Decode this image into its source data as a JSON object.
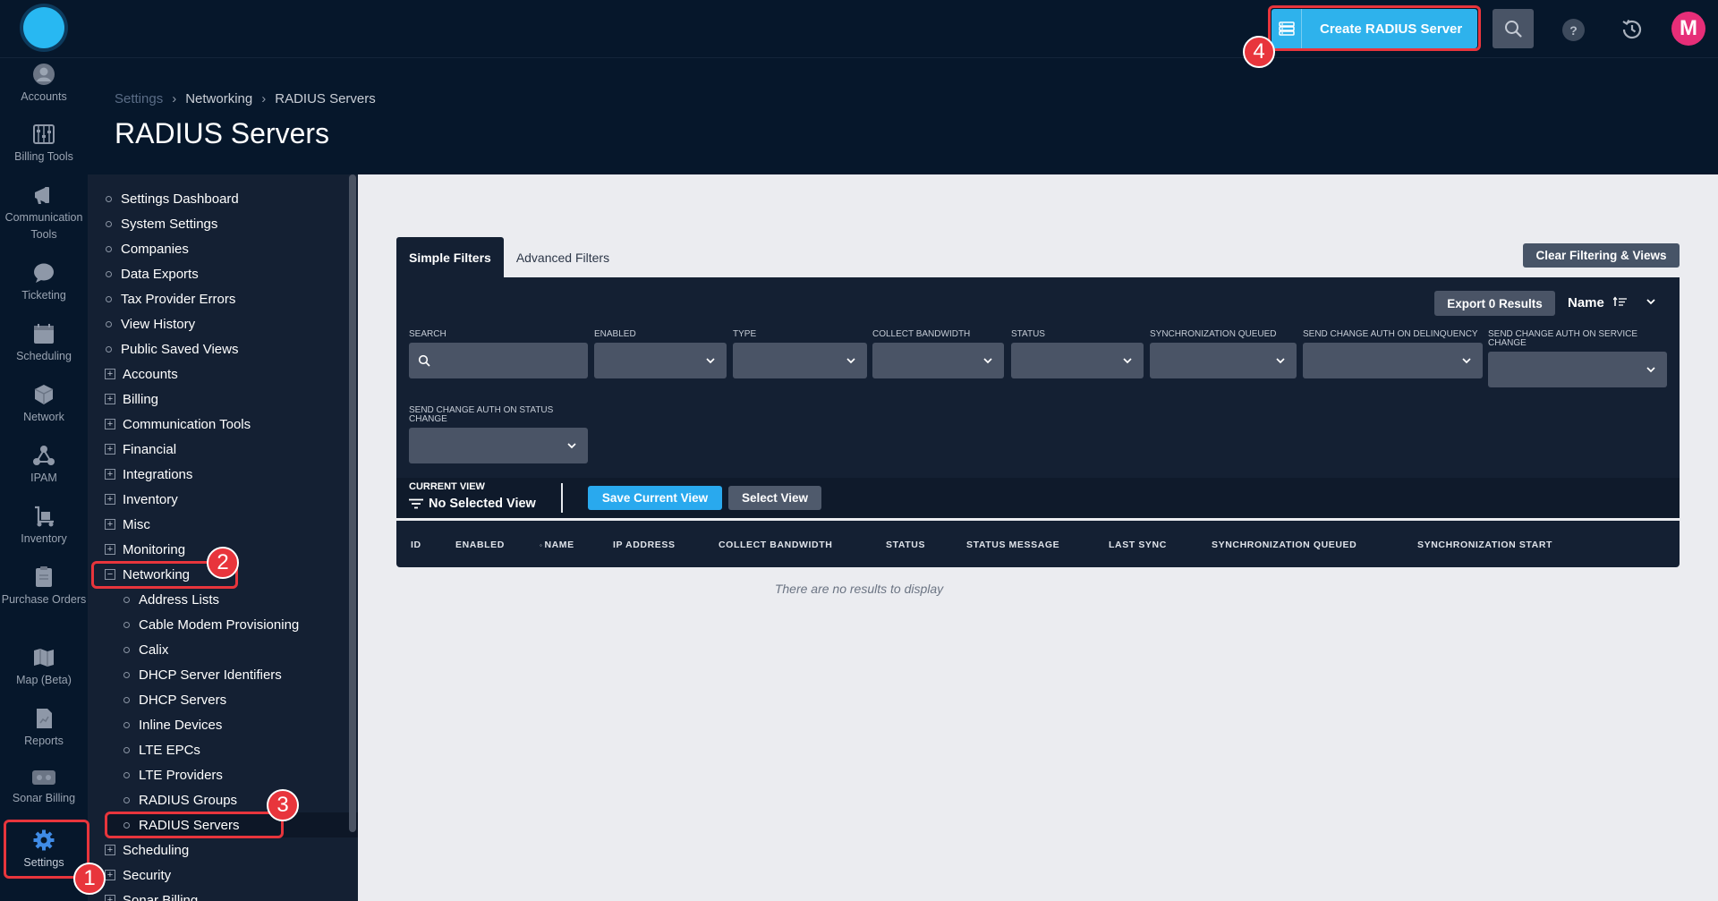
{
  "top_bar": {
    "create_button_label": "Create RADIUS Server",
    "avatar_initial": "M",
    "help_label": "?"
  },
  "rail": {
    "items": [
      {
        "label": "Accounts",
        "icon": "user-icon"
      },
      {
        "label": "Billing Tools",
        "icon": "abacus-icon"
      },
      {
        "label": "Communication Tools",
        "icon": "megaphone-icon"
      },
      {
        "label": "Ticketing",
        "icon": "chat-icon"
      },
      {
        "label": "Scheduling",
        "icon": "calendar-icon"
      },
      {
        "label": "Network",
        "icon": "cubes-icon"
      },
      {
        "label": "IPAM",
        "icon": "network-nodes-icon"
      },
      {
        "label": "Inventory",
        "icon": "hand-truck-icon"
      },
      {
        "label": "Purchase Orders",
        "icon": "clipboard-icon"
      },
      {
        "label": "Map (Beta)",
        "icon": "map-icon"
      },
      {
        "label": "Reports",
        "icon": "report-icon"
      },
      {
        "label": "Sonar Billing",
        "icon": "card-icon"
      },
      {
        "label": "Settings",
        "icon": "gear-icon"
      }
    ]
  },
  "breadcrumb": {
    "items": [
      "Settings",
      "Networking",
      "RADIUS Servers"
    ],
    "separator": "›"
  },
  "page_title": "RADIUS Servers",
  "settings_tree": {
    "items": [
      {
        "label": "Settings Dashboard",
        "type": "leaf"
      },
      {
        "label": "System Settings",
        "type": "leaf"
      },
      {
        "label": "Companies",
        "type": "leaf"
      },
      {
        "label": "Data Exports",
        "type": "leaf"
      },
      {
        "label": "Tax Provider Errors",
        "type": "leaf"
      },
      {
        "label": "View History",
        "type": "leaf"
      },
      {
        "label": "Public Saved Views",
        "type": "leaf"
      },
      {
        "label": "Accounts",
        "type": "collapsed"
      },
      {
        "label": "Billing",
        "type": "collapsed"
      },
      {
        "label": "Communication Tools",
        "type": "collapsed"
      },
      {
        "label": "Financial",
        "type": "collapsed"
      },
      {
        "label": "Integrations",
        "type": "collapsed"
      },
      {
        "label": "Inventory",
        "type": "collapsed"
      },
      {
        "label": "Misc",
        "type": "collapsed"
      },
      {
        "label": "Monitoring",
        "type": "collapsed"
      },
      {
        "label": "Networking",
        "type": "expanded"
      },
      {
        "label": "Address Lists",
        "type": "child"
      },
      {
        "label": "Cable Modem Provisioning",
        "type": "child"
      },
      {
        "label": "Calix",
        "type": "child"
      },
      {
        "label": "DHCP Server Identifiers",
        "type": "child"
      },
      {
        "label": "DHCP Servers",
        "type": "child"
      },
      {
        "label": "Inline Devices",
        "type": "child"
      },
      {
        "label": "LTE EPCs",
        "type": "child"
      },
      {
        "label": "LTE Providers",
        "type": "child"
      },
      {
        "label": "RADIUS Groups",
        "type": "child"
      },
      {
        "label": "RADIUS Servers",
        "type": "child"
      },
      {
        "label": "Scheduling",
        "type": "collapsed"
      },
      {
        "label": "Security",
        "type": "collapsed"
      },
      {
        "label": "Sonar Billing",
        "type": "collapsed"
      }
    ],
    "box_plus": "+",
    "box_minus": "−"
  },
  "filters": {
    "tabs": [
      "Simple Filters",
      "Advanced Filters"
    ],
    "clear_label": "Clear Filtering & Views",
    "export_label": "Export 0 Results",
    "sort_label": "Name",
    "fields": [
      {
        "label": "Search",
        "type": "search"
      },
      {
        "label": "Enabled",
        "type": "select"
      },
      {
        "label": "Type",
        "type": "select"
      },
      {
        "label": "Collect Bandwidth",
        "type": "select"
      },
      {
        "label": "Status",
        "type": "select"
      },
      {
        "label": "Synchronization Queued",
        "type": "select"
      },
      {
        "label": "Send Change Auth on Delinquency",
        "type": "select"
      },
      {
        "label": "Send Change Auth on Service Change",
        "type": "select"
      },
      {
        "label": "Send Change Auth on Status Change",
        "type": "select"
      }
    ]
  },
  "current_view": {
    "label": "CURRENT VIEW",
    "value": "No Selected View",
    "save_label": "Save Current View",
    "select_label": "Select View"
  },
  "table": {
    "columns": [
      "ID",
      "ENABLED",
      "NAME",
      "IP ADDRESS",
      "COLLECT BANDWIDTH",
      "STATUS",
      "STATUS MESSAGE",
      "LAST SYNC",
      "SYNCHRONIZATION QUEUED",
      "SYNCHRONIZATION START"
    ],
    "sort_marker": "◦",
    "empty_message": "There are no results to display"
  },
  "annotations": {
    "badges": [
      "1",
      "2",
      "3",
      "4"
    ],
    "color": "#e8353c"
  },
  "colors": {
    "accent": "#2eb2ec",
    "nav_bg": "#06172b",
    "panel_bg": "#142033",
    "avatar": "#e62e78"
  }
}
